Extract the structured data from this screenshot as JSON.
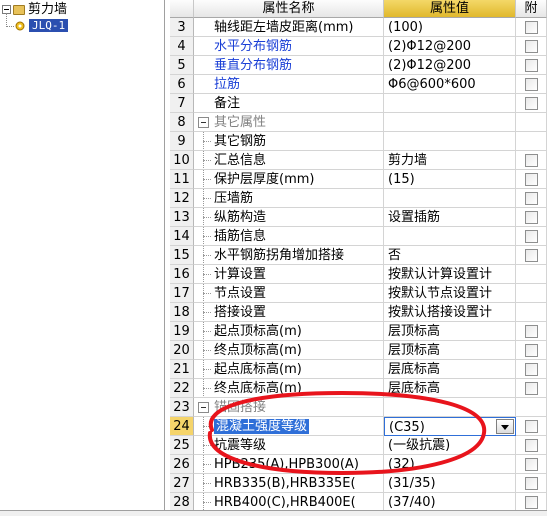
{
  "tree": {
    "root_label": "剪力墙",
    "child_label": "JLQ-1"
  },
  "grid": {
    "headers": {
      "name": "属性名称",
      "value": "属性值",
      "attach": "附"
    },
    "rows": [
      {
        "num": "3",
        "name": "轴线距左墙皮距离(mm)",
        "value": "(100)",
        "style": "plain",
        "indent": 0,
        "checkbox": true
      },
      {
        "num": "4",
        "name": "水平分布钢筋",
        "value": "(2)Φ12@200",
        "style": "blue",
        "indent": 0,
        "checkbox": true
      },
      {
        "num": "5",
        "name": "垂直分布钢筋",
        "value": "(2)Φ12@200",
        "style": "blue",
        "indent": 0,
        "checkbox": true
      },
      {
        "num": "6",
        "name": "拉筋",
        "value": "Φ6@600*600",
        "style": "blue",
        "indent": 0,
        "checkbox": true
      },
      {
        "num": "7",
        "name": "备注",
        "value": "",
        "style": "plain",
        "indent": 0,
        "checkbox": true
      },
      {
        "num": "8",
        "name": "其它属性",
        "value": "",
        "style": "group",
        "indent": 0,
        "checkbox": false
      },
      {
        "num": "9",
        "name": "其它钢筋",
        "value": "",
        "style": "plain",
        "indent": 1,
        "checkbox": false
      },
      {
        "num": "10",
        "name": "汇总信息",
        "value": "剪力墙",
        "style": "plain",
        "indent": 1,
        "checkbox": true
      },
      {
        "num": "11",
        "name": "保护层厚度(mm)",
        "value": "(15)",
        "style": "plain",
        "indent": 1,
        "checkbox": true
      },
      {
        "num": "12",
        "name": "压墙筋",
        "value": "",
        "style": "plain",
        "indent": 1,
        "checkbox": true
      },
      {
        "num": "13",
        "name": "纵筋构造",
        "value": "设置插筋",
        "style": "plain",
        "indent": 1,
        "checkbox": true
      },
      {
        "num": "14",
        "name": "插筋信息",
        "value": "",
        "style": "plain",
        "indent": 1,
        "checkbox": true
      },
      {
        "num": "15",
        "name": "水平钢筋拐角增加搭接",
        "value": "否",
        "style": "plain",
        "indent": 1,
        "checkbox": true
      },
      {
        "num": "16",
        "name": "计算设置",
        "value": "按默认计算设置计",
        "style": "plain",
        "indent": 1,
        "checkbox": false
      },
      {
        "num": "17",
        "name": "节点设置",
        "value": "按默认节点设置计",
        "style": "plain",
        "indent": 1,
        "checkbox": false
      },
      {
        "num": "18",
        "name": "搭接设置",
        "value": "按默认搭接设置计",
        "style": "plain",
        "indent": 1,
        "checkbox": false
      },
      {
        "num": "19",
        "name": "起点顶标高(m)",
        "value": "层顶标高",
        "style": "plain",
        "indent": 1,
        "checkbox": true
      },
      {
        "num": "20",
        "name": "终点顶标高(m)",
        "value": "层顶标高",
        "style": "plain",
        "indent": 1,
        "checkbox": true
      },
      {
        "num": "21",
        "name": "起点底标高(m)",
        "value": "层底标高",
        "style": "plain",
        "indent": 1,
        "checkbox": true
      },
      {
        "num": "22",
        "name": "终点底标高(m)",
        "value": "层底标高",
        "style": "plain",
        "indent": 1,
        "checkbox": true
      },
      {
        "num": "23",
        "name": "锚固搭接",
        "value": "",
        "style": "group",
        "indent": 0,
        "checkbox": false
      },
      {
        "num": "24",
        "name": "混凝土强度等级",
        "value": "(C35)",
        "style": "selected",
        "indent": 1,
        "checkbox": true
      },
      {
        "num": "25",
        "name": "抗震等级",
        "value": "(一级抗震)",
        "style": "plain",
        "indent": 1,
        "checkbox": true
      },
      {
        "num": "26",
        "name": "HPB235(A),HPB300(A)",
        "value": "(32)",
        "style": "plain",
        "indent": 1,
        "checkbox": true
      },
      {
        "num": "27",
        "name": "HRB335(B),HRB335E(",
        "value": "(31/35)",
        "style": "plain",
        "indent": 1,
        "checkbox": true
      },
      {
        "num": "28",
        "name": "HRB400(C),HRB400E(",
        "value": "(37/40)",
        "style": "plain",
        "indent": 1,
        "checkbox": true
      }
    ]
  },
  "colors": {
    "annotation": "#e8141c",
    "blue_text": "#1a3fd6",
    "header_value_bg": "#e8c440",
    "selection": "#2f6fd8"
  }
}
